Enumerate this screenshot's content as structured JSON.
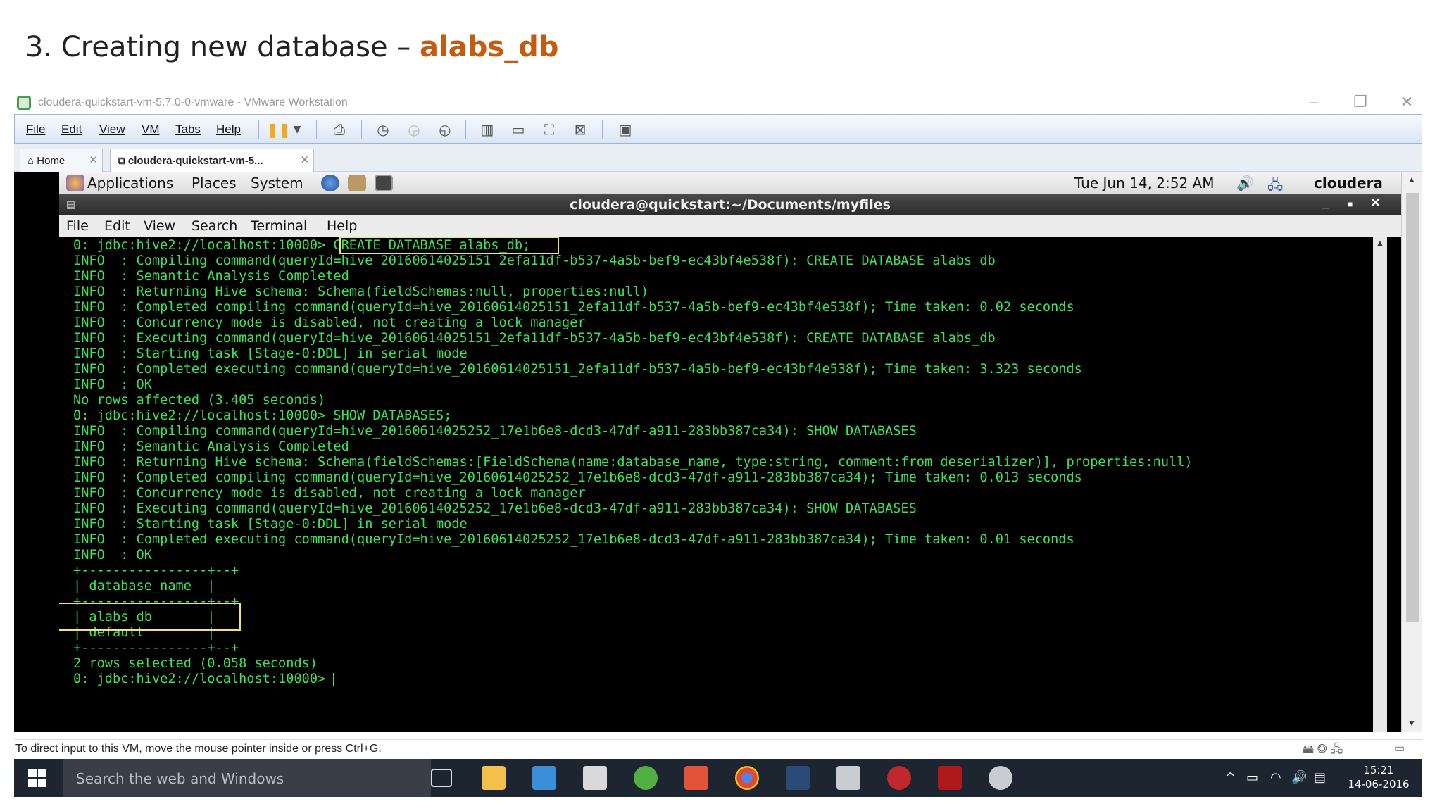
{
  "slide": {
    "title_prefix": "3. Creating new database – ",
    "title_accent": "alabs_db"
  },
  "vmware": {
    "window_title": "cloudera-quickstart-vm-5.7.0-0-vmware - VMware Workstation",
    "menu": [
      "File",
      "Edit",
      "View",
      "VM",
      "Tabs",
      "Help"
    ],
    "tabs": [
      {
        "label": "Home"
      },
      {
        "label": "cloudera-quickstart-vm-5..."
      }
    ],
    "status_text": "To direct input to this VM, move the mouse pointer inside or press Ctrl+G."
  },
  "gnome_panel": {
    "applications": "Applications",
    "places": "Places",
    "system": "System",
    "datetime": "Tue Jun 14,  2:52 AM",
    "user": "cloudera"
  },
  "terminal": {
    "title": "cloudera@quickstart:~/Documents/myfiles",
    "menu": [
      "File",
      "Edit",
      "View",
      "Search",
      "Terminal",
      "Help"
    ],
    "lines": [
      "0: jdbc:hive2://localhost:10000> CREATE DATABASE alabs_db;",
      "INFO  : Compiling command(queryId=hive_20160614025151_2efa11df-b537-4a5b-bef9-ec43bf4e538f): CREATE DATABASE alabs_db",
      "INFO  : Semantic Analysis Completed",
      "INFO  : Returning Hive schema: Schema(fieldSchemas:null, properties:null)",
      "INFO  : Completed compiling command(queryId=hive_20160614025151_2efa11df-b537-4a5b-bef9-ec43bf4e538f); Time taken: 0.02 seconds",
      "INFO  : Concurrency mode is disabled, not creating a lock manager",
      "INFO  : Executing command(queryId=hive_20160614025151_2efa11df-b537-4a5b-bef9-ec43bf4e538f): CREATE DATABASE alabs_db",
      "INFO  : Starting task [Stage-0:DDL] in serial mode",
      "INFO  : Completed executing command(queryId=hive_20160614025151_2efa11df-b537-4a5b-bef9-ec43bf4e538f); Time taken: 3.323 seconds",
      "INFO  : OK",
      "No rows affected (3.405 seconds)",
      "0: jdbc:hive2://localhost:10000> SHOW DATABASES;",
      "INFO  : Compiling command(queryId=hive_20160614025252_17e1b6e8-dcd3-47df-a911-283bb387ca34): SHOW DATABASES",
      "INFO  : Semantic Analysis Completed",
      "INFO  : Returning Hive schema: Schema(fieldSchemas:[FieldSchema(name:database_name, type:string, comment:from deserializer)], properties:null)",
      "INFO  : Completed compiling command(queryId=hive_20160614025252_17e1b6e8-dcd3-47df-a911-283bb387ca34); Time taken: 0.013 seconds",
      "INFO  : Concurrency mode is disabled, not creating a lock manager",
      "INFO  : Executing command(queryId=hive_20160614025252_17e1b6e8-dcd3-47df-a911-283bb387ca34): SHOW DATABASES",
      "INFO  : Starting task [Stage-0:DDL] in serial mode",
      "INFO  : Completed executing command(queryId=hive_20160614025252_17e1b6e8-dcd3-47df-a911-283bb387ca34); Time taken: 0.01 seconds",
      "INFO  : OK",
      "+----------------+--+",
      "| database_name  |",
      "+----------------+--+",
      "| alabs_db       |",
      "| default        |",
      "+----------------+--+",
      "2 rows selected (0.058 seconds)",
      "0: jdbc:hive2://localhost:10000> "
    ]
  },
  "taskbar": {
    "search_placeholder": "Search the web and Windows",
    "time": "15:21",
    "date": "14-06-2016"
  },
  "colors": {
    "accent": "#c55a11",
    "terminal_text": "#3ee05a",
    "highlight_box": "#f4e36a",
    "taskbar": "#1d2530"
  }
}
